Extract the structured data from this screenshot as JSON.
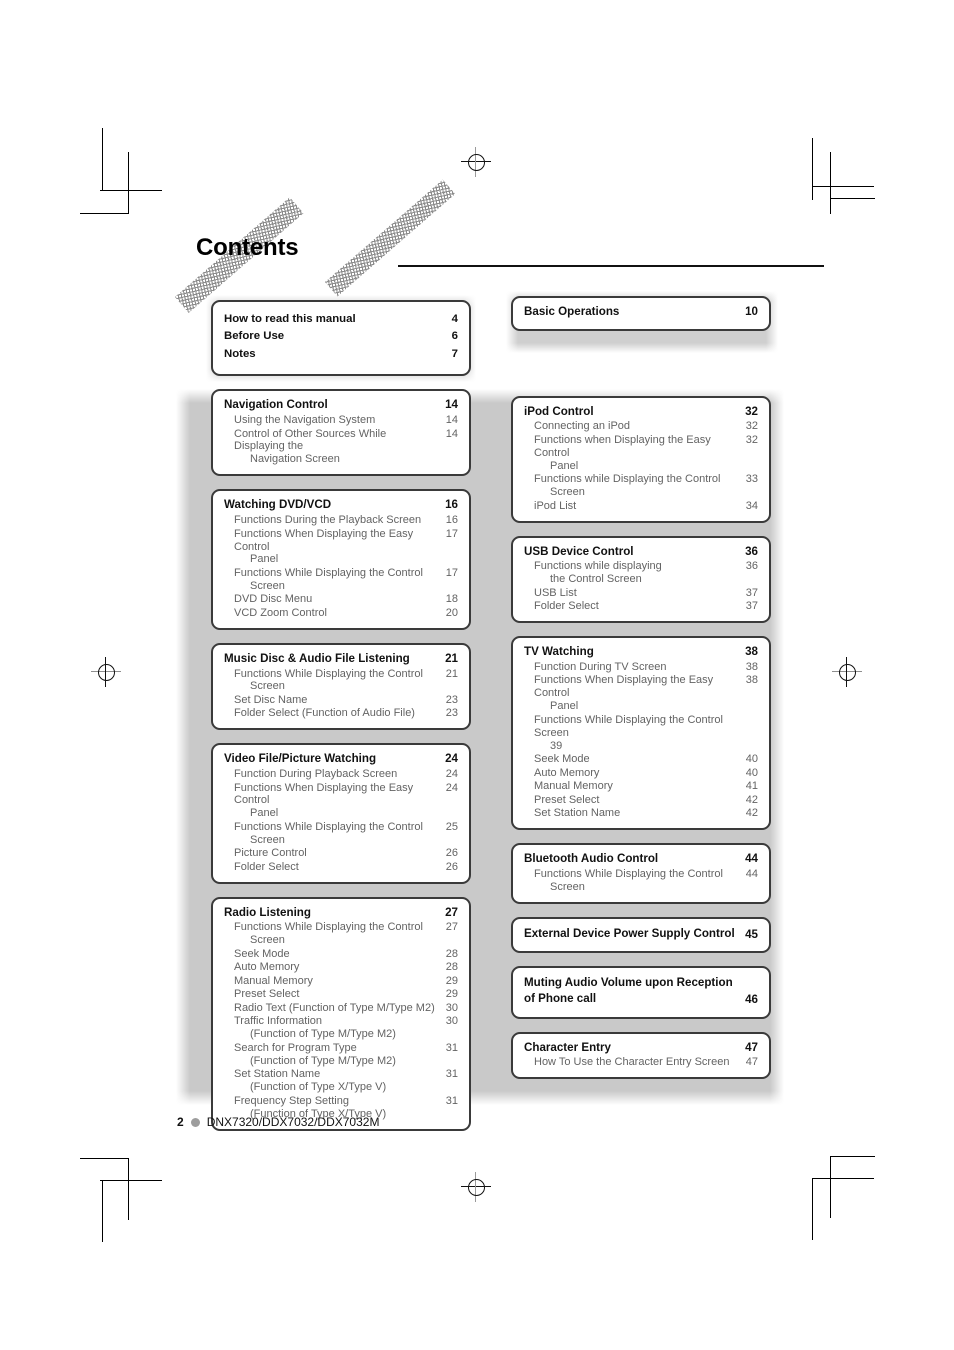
{
  "header": {
    "title": "Contents"
  },
  "footer": {
    "page_number": "2",
    "models": "DNX7320/DDX7032/DDX7032M"
  },
  "left_column": [
    {
      "type": "front_matter",
      "rows": [
        {
          "label": "How to read this manual",
          "page": "4"
        },
        {
          "label": "Before Use",
          "page": "6"
        },
        {
          "label": "Notes",
          "page": "7"
        }
      ]
    },
    {
      "type": "chapter",
      "chapter": {
        "label": "Navigation Control",
        "page": "14"
      },
      "entries": [
        {
          "label": "Using the Navigation System",
          "cont": "",
          "page": "14"
        },
        {
          "label": "Control of Other Sources While Displaying the",
          "cont": "Navigation Screen",
          "page": "14"
        }
      ]
    },
    {
      "type": "chapter",
      "chapter": {
        "label": "Watching DVD/VCD",
        "page": "16"
      },
      "entries": [
        {
          "label": "Functions During the Playback Screen",
          "cont": "",
          "page": "16"
        },
        {
          "label": "Functions When Displaying the Easy Control",
          "cont": "Panel",
          "page": "17"
        },
        {
          "label": "Functions While Displaying the Control",
          "cont": "Screen",
          "page": "17"
        },
        {
          "label": "DVD Disc Menu",
          "cont": "",
          "page": "18"
        },
        {
          "label": "VCD Zoom Control",
          "cont": "",
          "page": "20"
        }
      ]
    },
    {
      "type": "chapter",
      "chapter": {
        "label": "Music Disc & Audio File Listening",
        "page": "21"
      },
      "entries": [
        {
          "label": "Functions While Displaying the Control",
          "cont": "Screen",
          "page": "21"
        },
        {
          "label": "Set Disc Name",
          "cont": "",
          "page": "23"
        },
        {
          "label": "Folder Select (Function of Audio File)",
          "cont": "",
          "page": "23"
        }
      ]
    },
    {
      "type": "chapter",
      "chapter": {
        "label": "Video File/Picture Watching",
        "page": "24"
      },
      "entries": [
        {
          "label": "Function During Playback Screen",
          "cont": "",
          "page": "24"
        },
        {
          "label": "Functions When Displaying the Easy Control",
          "cont": "Panel",
          "page": "24"
        },
        {
          "label": "Functions While Displaying the Control",
          "cont": "Screen",
          "page": "25"
        },
        {
          "label": "Picture Control",
          "cont": "",
          "page": "26"
        },
        {
          "label": "Folder Select",
          "cont": "",
          "page": "26"
        }
      ]
    },
    {
      "type": "chapter",
      "chapter": {
        "label": "Radio Listening",
        "page": "27"
      },
      "entries": [
        {
          "label": "Functions While Displaying the Control",
          "cont": "Screen",
          "page": "27"
        },
        {
          "label": "Seek Mode",
          "cont": "",
          "page": "28"
        },
        {
          "label": "Auto Memory",
          "cont": "",
          "page": "28"
        },
        {
          "label": "Manual Memory",
          "cont": "",
          "page": "29"
        },
        {
          "label": "Preset Select",
          "cont": "",
          "page": "29"
        },
        {
          "label": "Radio Text (Function of Type M/Type M2)",
          "cont": "",
          "page": "30"
        },
        {
          "label": "Traffic Information",
          "cont": "(Function of Type M/Type M2)",
          "page": "30"
        },
        {
          "label": "Search for Program Type",
          "cont": "(Function of Type M/Type M2)",
          "page": "31"
        },
        {
          "label": "Set Station Name",
          "cont": "(Function of Type X/Type V)",
          "page": "31"
        },
        {
          "label": "Frequency Step Setting",
          "cont": "(Function of Type X/Type V)",
          "page": "31"
        }
      ]
    }
  ],
  "right_column": [
    {
      "type": "chapter_only",
      "chapter": {
        "label": "Basic Operations",
        "page": "10"
      },
      "entries": []
    },
    {
      "type": "chapter",
      "chapter": {
        "label": "iPod Control",
        "page": "32"
      },
      "entries": [
        {
          "label": "Connecting an iPod",
          "cont": "",
          "page": "32"
        },
        {
          "label": "Functions when Displaying the Easy Control",
          "cont": "Panel",
          "page": "32"
        },
        {
          "label": "Functions while Displaying the Control",
          "cont": "Screen",
          "page": "33"
        },
        {
          "label": "iPod List",
          "cont": "",
          "page": "34"
        }
      ]
    },
    {
      "type": "chapter",
      "chapter": {
        "label": "USB Device Control",
        "page": "36"
      },
      "entries": [
        {
          "label": "Functions while displaying",
          "cont": "the Control Screen",
          "page": "36"
        },
        {
          "label": "USB List",
          "cont": "",
          "page": "37"
        },
        {
          "label": "Folder Select",
          "cont": "",
          "page": "37"
        }
      ]
    },
    {
      "type": "chapter",
      "chapter": {
        "label": "TV Watching",
        "page": "38"
      },
      "entries": [
        {
          "label": "Function During TV Screen",
          "cont": "",
          "page": "38"
        },
        {
          "label": "Functions When Displaying the Easy Control",
          "cont": "Panel",
          "page": "38"
        },
        {
          "label": "Functions While Displaying the Control Screen",
          "cont": "39",
          "page": ""
        },
        {
          "label": "Seek Mode",
          "cont": "",
          "page": "40"
        },
        {
          "label": "Auto Memory",
          "cont": "",
          "page": "40"
        },
        {
          "label": "Manual Memory",
          "cont": "",
          "page": "41"
        },
        {
          "label": "Preset Select",
          "cont": "",
          "page": "42"
        },
        {
          "label": "Set Station Name",
          "cont": "",
          "page": "42"
        }
      ]
    },
    {
      "type": "chapter",
      "chapter": {
        "label": "Bluetooth Audio Control",
        "page": "44"
      },
      "entries": [
        {
          "label": "Functions While Displaying the Control",
          "cont": "Screen",
          "page": "44"
        }
      ]
    },
    {
      "type": "chapter_wrap",
      "chapter": {
        "label": "External Device Power Supply Control",
        "page": "45"
      },
      "entries": []
    },
    {
      "type": "chapter_wrap",
      "chapter": {
        "label": "Muting Audio Volume upon Reception of Phone call",
        "page": "46"
      },
      "entries": []
    },
    {
      "type": "chapter",
      "chapter": {
        "label": "Character Entry",
        "page": "47"
      },
      "entries": [
        {
          "label": "How To Use the Character Entry Screen",
          "cont": "",
          "page": "47"
        }
      ]
    }
  ]
}
